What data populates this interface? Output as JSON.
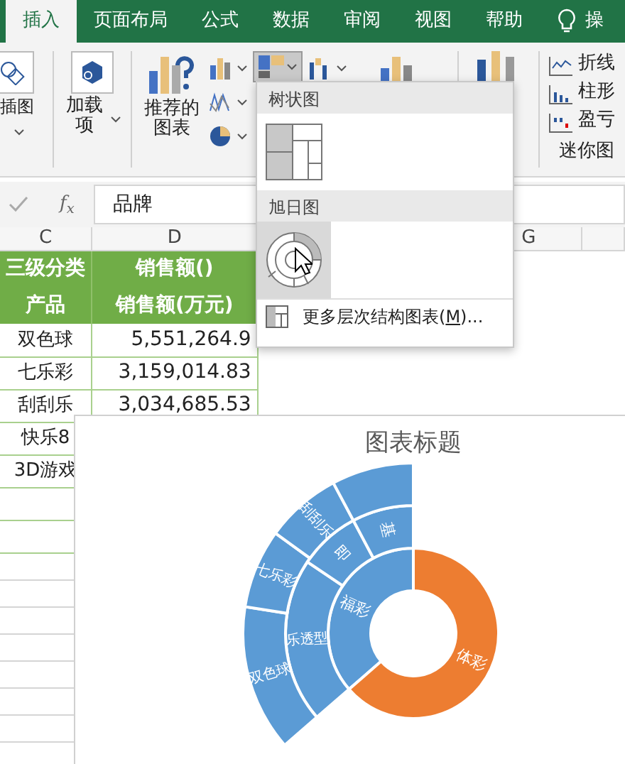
{
  "tabs": [
    {
      "label": "插入",
      "selected": true
    },
    {
      "label": "页面布局",
      "selected": false
    },
    {
      "label": "公式",
      "selected": false
    },
    {
      "label": "数据",
      "selected": false
    },
    {
      "label": "审阅",
      "selected": false
    },
    {
      "label": "视图",
      "selected": false
    },
    {
      "label": "帮助",
      "selected": false
    }
  ],
  "tell_me": {
    "label": "操"
  },
  "ribbon": {
    "illustrations": {
      "label": "插图"
    },
    "addins": {
      "label": "加载项"
    },
    "recommended": {
      "label": "推荐的图表"
    },
    "hierarchy_button": {
      "selected": true
    },
    "sparklines": {
      "items": [
        "折线",
        "柱形",
        "盈亏"
      ],
      "label": "迷你图"
    }
  },
  "formula_bar": {
    "fx": "f$_{x}$",
    "value": "品牌"
  },
  "sheet": {
    "column_headers": [
      "C",
      "D",
      "G"
    ],
    "rows": [
      {
        "kind": "header",
        "cells": [
          "三级分类",
          "销售额()"
        ]
      },
      {
        "kind": "header",
        "cells": [
          "产品",
          "销售额(万元)"
        ]
      },
      {
        "kind": "data",
        "cells": [
          "双色球",
          "5,551,264.9"
        ]
      },
      {
        "kind": "data",
        "cells": [
          "七乐彩",
          "3,159,014.83"
        ]
      },
      {
        "kind": "data",
        "cells": [
          "刮刮乐",
          "3,034,685.53"
        ]
      },
      {
        "kind": "data",
        "cells": [
          "快乐8"
        ]
      },
      {
        "kind": "data",
        "cells": [
          "3D游戏"
        ]
      }
    ]
  },
  "popup": {
    "sections": [
      {
        "header": "树状图",
        "kind": "treemap",
        "selected": false
      },
      {
        "header": "旭日图",
        "kind": "sunburst",
        "selected": true
      }
    ],
    "more": {
      "text": "更多层次结构图表(",
      "accesskey": "M",
      "after": ")..."
    }
  },
  "chart": {
    "title": "图表标题",
    "segments": [
      {
        "label": "福彩",
        "color": "#5b9bd5",
        "children": [
          {
            "label": "乐透型",
            "children": [
              {
                "kind": "labeled",
                "label": "双色球"
              },
              {
                "kind": "labeled",
                "label": "七乐彩"
              }
            ]
          },
          {
            "label": "即",
            "children": [
              {
                "kind": "labeled",
                "label": "刮刮乐"
              }
            ]
          },
          {
            "label": "基",
            "children": [
              {
                "kind": "blank"
              }
            ]
          }
        ]
      },
      {
        "label": "体彩",
        "color": "#ed7d31"
      }
    ]
  }
}
